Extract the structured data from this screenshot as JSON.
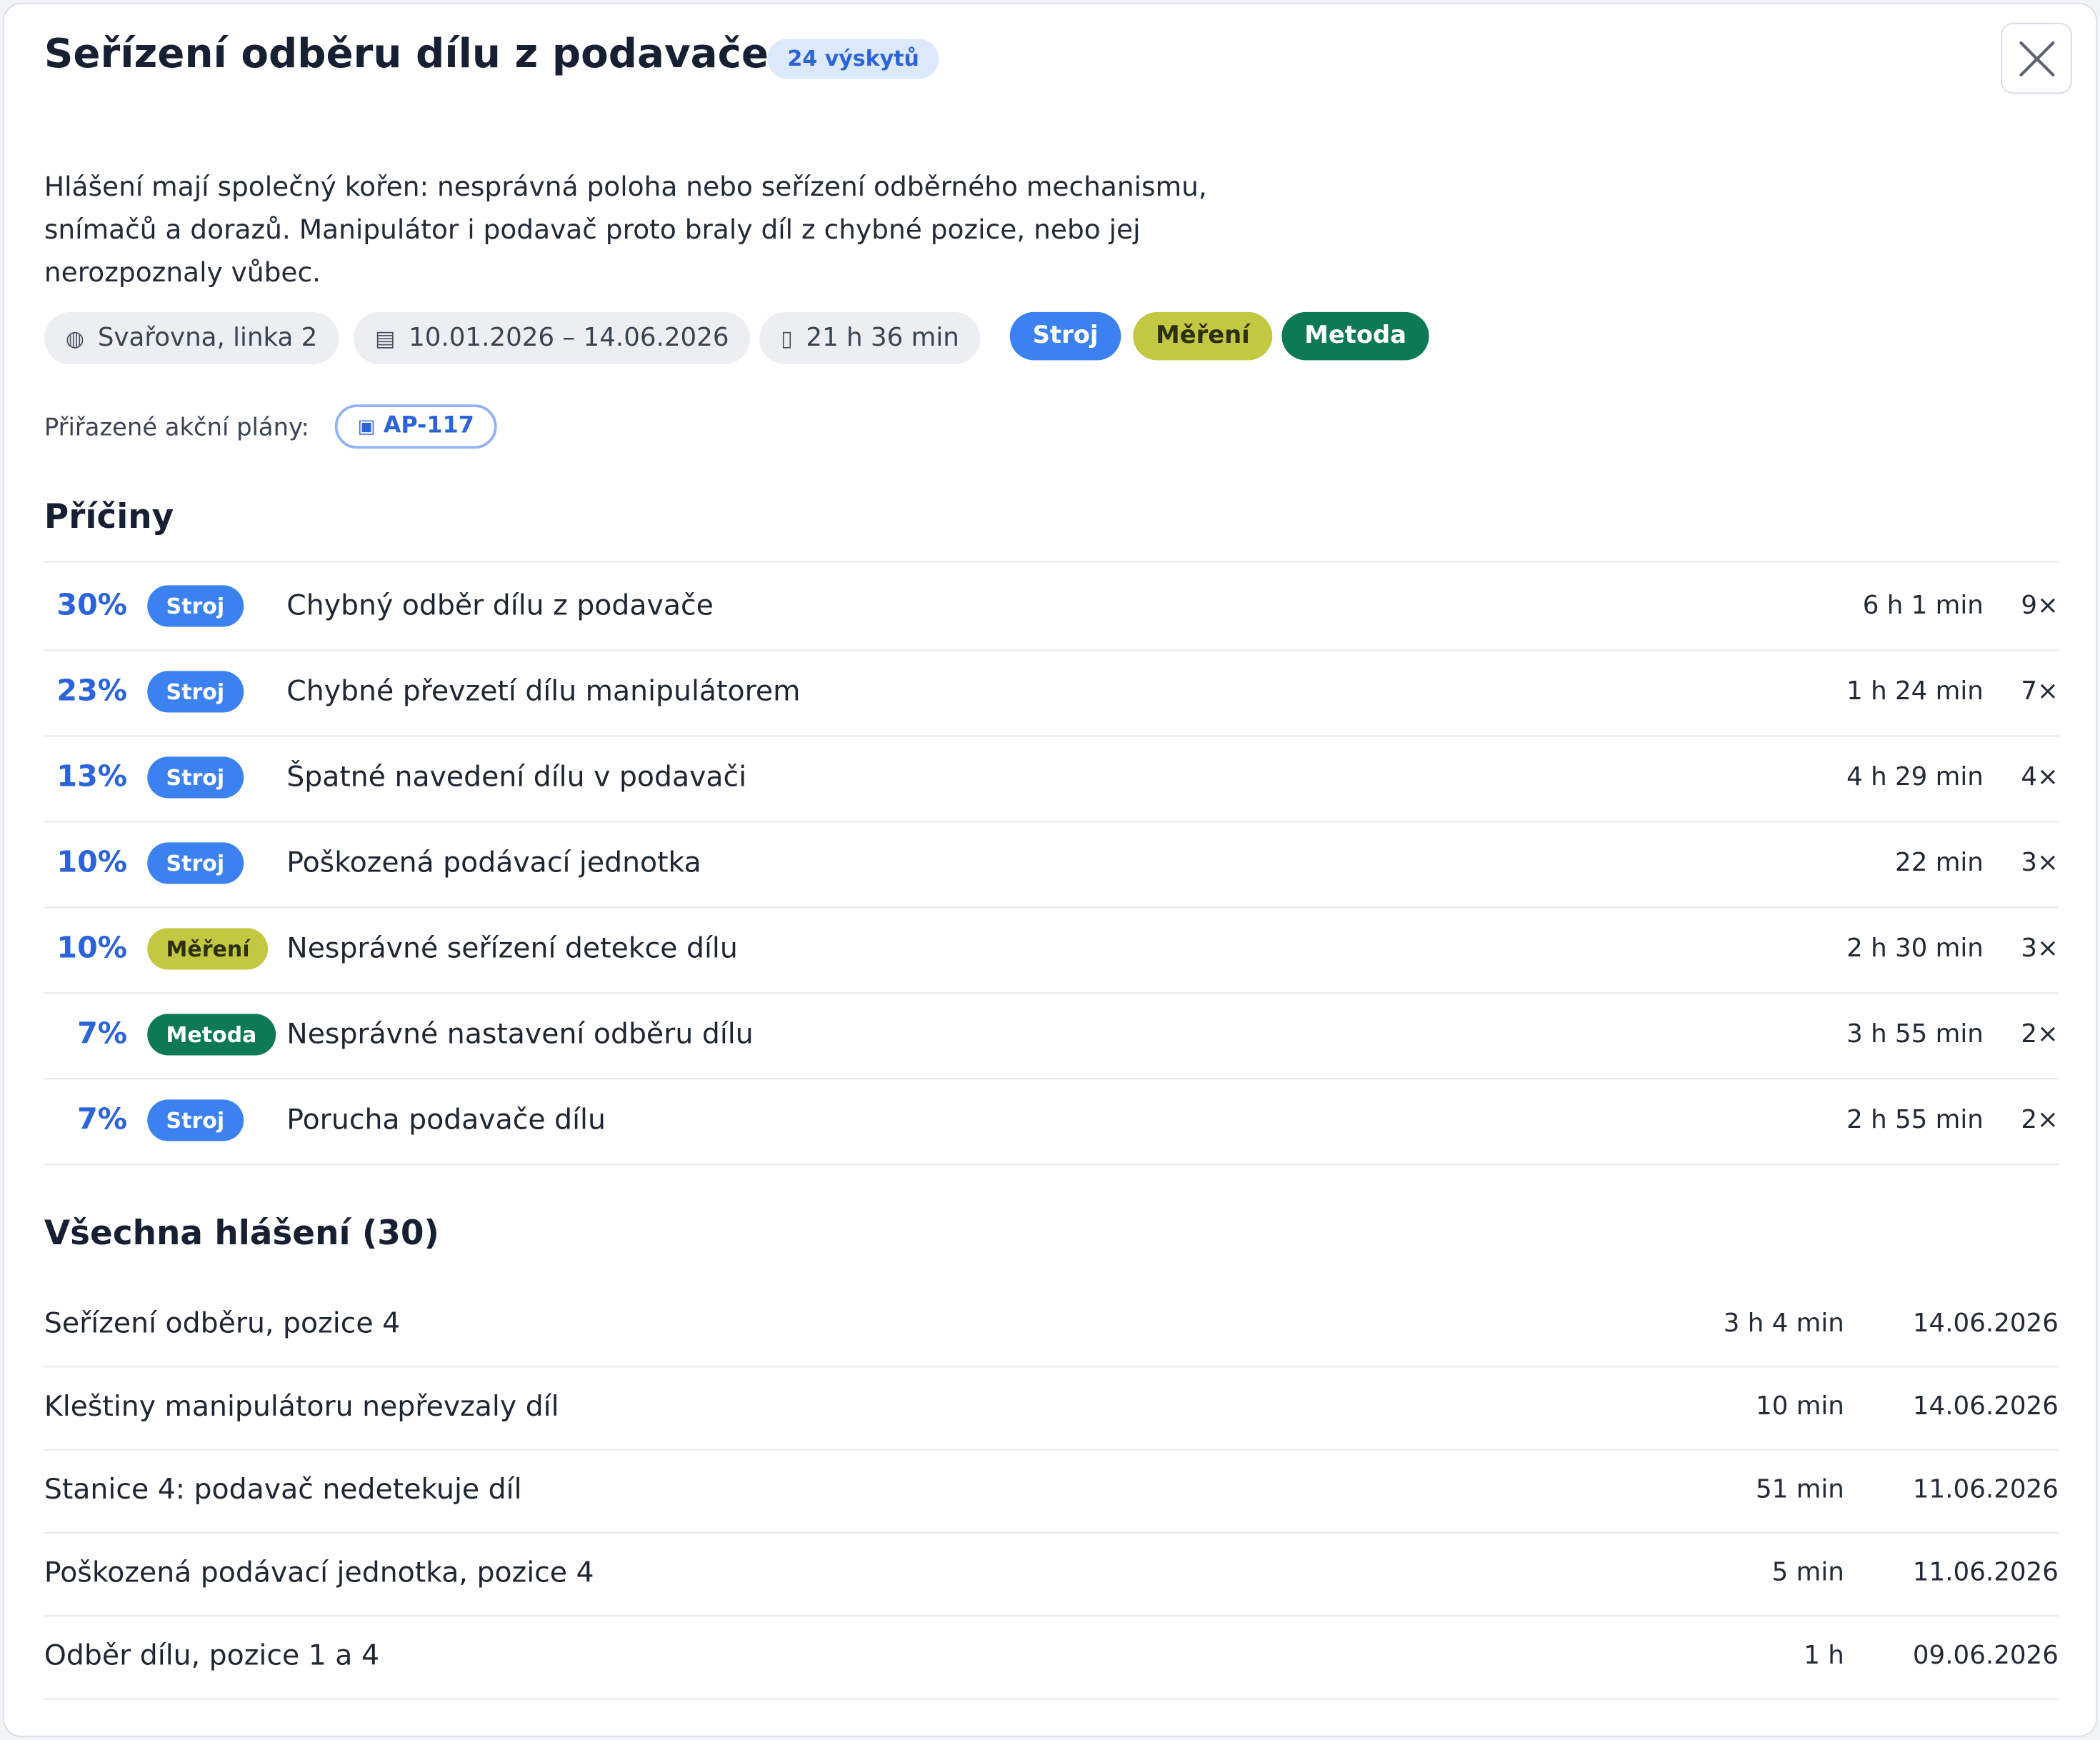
{
  "dialog": {
    "title": "Seřízení odběru dílu z podavače",
    "occurrences_badge": "24 výskytů",
    "description": "Hlášení mají společný kořen: nesprávná poloha nebo seřízení odběrného mechanismu, snímačů a dorazů. Manipulátor i podavač proto braly díl z chybné pozice, nebo jej nerozpoznaly vůbec.",
    "close_icon": "close-icon"
  },
  "meta": {
    "location": "Svařovna, linka 2",
    "location_icon": "◍",
    "date_range": "10.01.2026 – 14.06.2026",
    "date_icon": "▤",
    "duration": "21 h 36 min",
    "duration_icon": "▯",
    "categories": [
      "Stroj",
      "Měření",
      "Metoda"
    ]
  },
  "action_plans": {
    "label": "Přiřazené akční plány:",
    "icon": "▣",
    "items": [
      "AP-117"
    ]
  },
  "colors": {
    "Stroj": "#3b82f0",
    "Měření": "#c2c842",
    "Metoda": "#0d7a55",
    "accent": "#2b63d9"
  },
  "causes": {
    "title": "Příčiny",
    "rows": [
      {
        "pct": "30%",
        "category": "Stroj",
        "name": "Chybný odběr dílu z podavače",
        "duration": "6 h 1 min",
        "count": "9×"
      },
      {
        "pct": "23%",
        "category": "Stroj",
        "name": "Chybné převzetí dílu manipulátorem",
        "duration": "1 h 24 min",
        "count": "7×"
      },
      {
        "pct": "13%",
        "category": "Stroj",
        "name": "Špatné navedení dílu v podavači",
        "duration": "4 h 29 min",
        "count": "4×"
      },
      {
        "pct": "10%",
        "category": "Stroj",
        "name": "Poškozená podávací jednotka",
        "duration": "22 min",
        "count": "3×"
      },
      {
        "pct": "10%",
        "category": "Měření",
        "name": "Nesprávné seřízení detekce dílu",
        "duration": "2 h 30 min",
        "count": "3×"
      },
      {
        "pct": "7%",
        "category": "Metoda",
        "name": "Nesprávné nastavení odběru dílu",
        "duration": "3 h 55 min",
        "count": "2×"
      },
      {
        "pct": "7%",
        "category": "Stroj",
        "name": "Porucha podavače dílu",
        "duration": "2 h 55 min",
        "count": "2×"
      }
    ]
  },
  "reports": {
    "title": "Všechna hlášení (30)",
    "rows": [
      {
        "name": "Seřízení odběru, pozice 4",
        "duration": "3 h 4 min",
        "date": "14.06.2026"
      },
      {
        "name": "Kleštiny manipulátoru nepřevzaly díl",
        "duration": "10 min",
        "date": "14.06.2026"
      },
      {
        "name": "Stanice 4: podavač nedetekuje díl",
        "duration": "51 min",
        "date": "11.06.2026"
      },
      {
        "name": "Poškozená podávací jednotka, pozice 4",
        "duration": "5 min",
        "date": "11.06.2026"
      },
      {
        "name": "Odběr dílu, pozice 1 a 4",
        "duration": "1 h",
        "date": "09.06.2026"
      }
    ]
  }
}
